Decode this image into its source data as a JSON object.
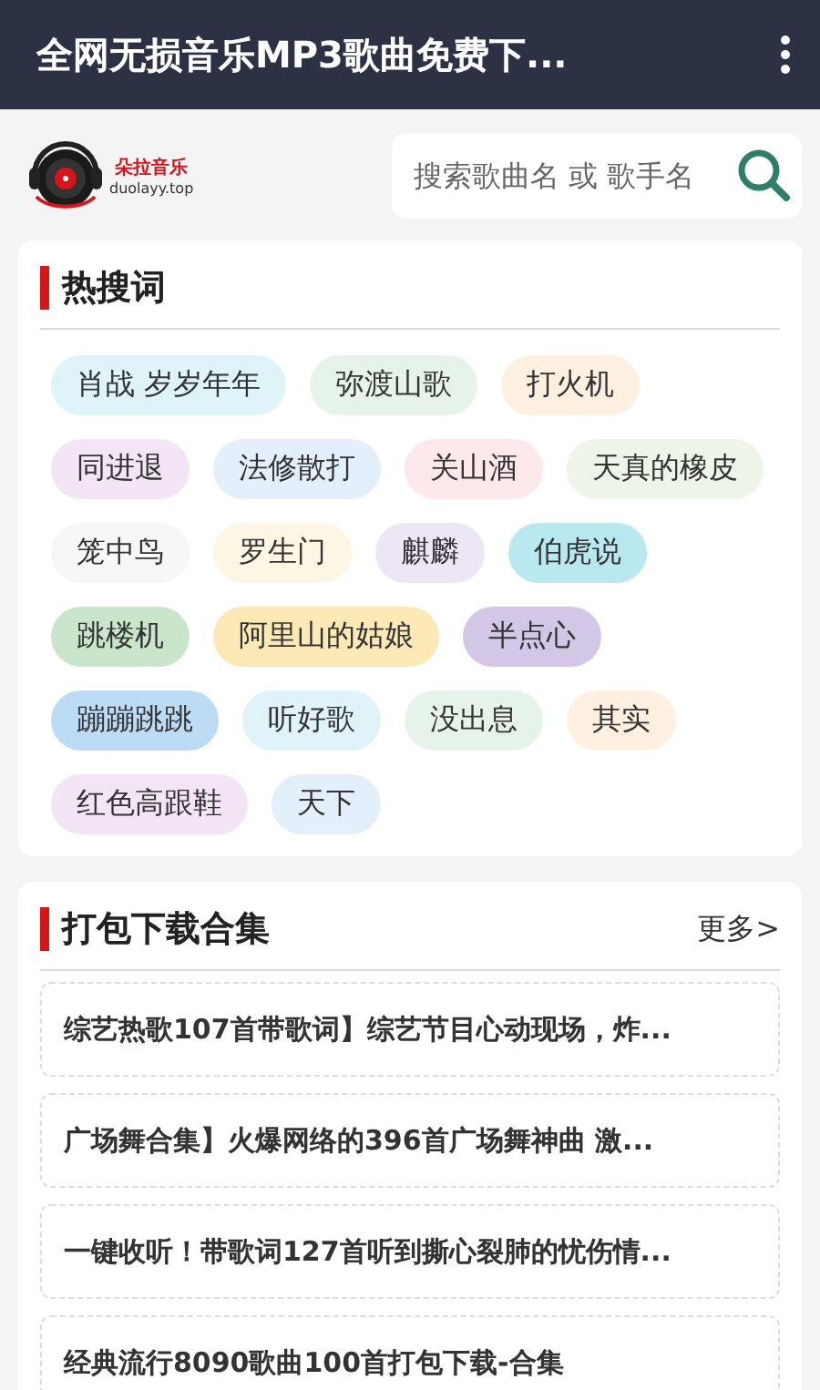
{
  "app_bar": {
    "title": "全网无损音乐MP3歌曲免费下..."
  },
  "logo": {
    "name": "朵拉音乐",
    "domain": "duolayy.top"
  },
  "search": {
    "placeholder": "搜索歌曲名 或 歌手名"
  },
  "hot_searches": {
    "title": "热搜词",
    "tags": [
      {
        "label": "肖战 岁岁年年",
        "color": "#dff4f8"
      },
      {
        "label": "弥渡山歌",
        "color": "#e6f3e8"
      },
      {
        "label": "打火机",
        "color": "#fdf0e0"
      },
      {
        "label": "同进退",
        "color": "#f3e5f5"
      },
      {
        "label": "法修散打",
        "color": "#e3f0fb"
      },
      {
        "label": "关山酒",
        "color": "#fde8ec"
      },
      {
        "label": "天真的橡皮",
        "color": "#eef5e8"
      },
      {
        "label": "笼中鸟",
        "color": "#f7f7f7"
      },
      {
        "label": "罗生门",
        "color": "#fdf6e3"
      },
      {
        "label": "麒麟",
        "color": "#ece6f5"
      },
      {
        "label": "伯虎说",
        "color": "#b9e8f0"
      },
      {
        "label": "跳楼机",
        "color": "#c9e6cc"
      },
      {
        "label": "阿里山的姑娘",
        "color": "#fde9b5"
      },
      {
        "label": "半点心",
        "color": "#d2c7e6"
      },
      {
        "label": "蹦蹦跳跳",
        "color": "#bcdcf5"
      },
      {
        "label": "听好歌",
        "color": "#dff3f8"
      },
      {
        "label": "没出息",
        "color": "#e6f3e8"
      },
      {
        "label": "其实",
        "color": "#fdf0e0"
      },
      {
        "label": "红色高跟鞋",
        "color": "#f3e5f5"
      },
      {
        "label": "天下",
        "color": "#e3f0fb"
      }
    ]
  },
  "collections": {
    "title": "打包下载合集",
    "more": "更多>",
    "items": [
      "综艺热歌107首带歌词】综艺节目心动现场，炸...",
      "广场舞合集】火爆网络的396首广场舞神曲 激...",
      "一键收听！带歌词127首听到撕心裂肺的忧伤情...",
      "经典流行8090歌曲100首打包下载-合集"
    ]
  }
}
